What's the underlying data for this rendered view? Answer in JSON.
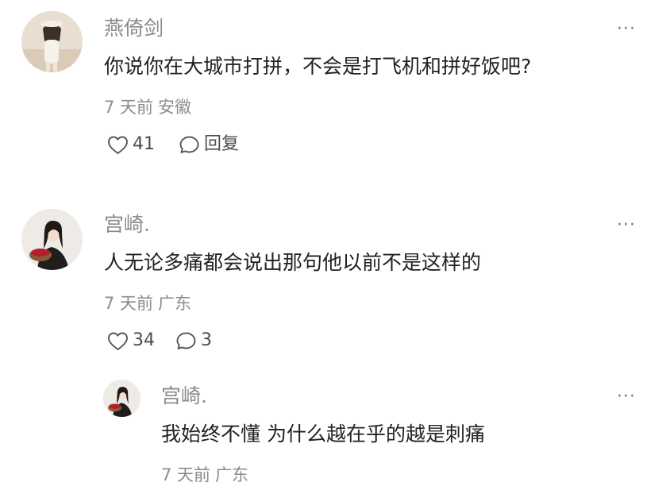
{
  "comments": [
    {
      "author": "燕倚剑",
      "text": "你说你在大城市打拼，不会是打飞机和拼好饭吧?",
      "time": "7 天前",
      "location": "安徽",
      "likes": "41",
      "reply_label": "回复"
    },
    {
      "author": "宫崎.",
      "text": "人无论多痛都会说出那句他以前不是这样的",
      "time": "7 天前",
      "location": "广东",
      "likes": "34",
      "reply_label": "3",
      "replies": [
        {
          "author": "宫崎.",
          "text": "我始终不懂 为什么越在乎的越是刺痛",
          "time": "7 天前",
          "location": "广东"
        }
      ]
    }
  ],
  "more_glyph": "···",
  "icons": [
    "heart-icon",
    "comment-bubble-icon",
    "more-options-icon"
  ],
  "colors": {
    "name": "#8a8a8a",
    "text": "#222222",
    "meta": "#8c8c8c",
    "background": "#ffffff"
  }
}
